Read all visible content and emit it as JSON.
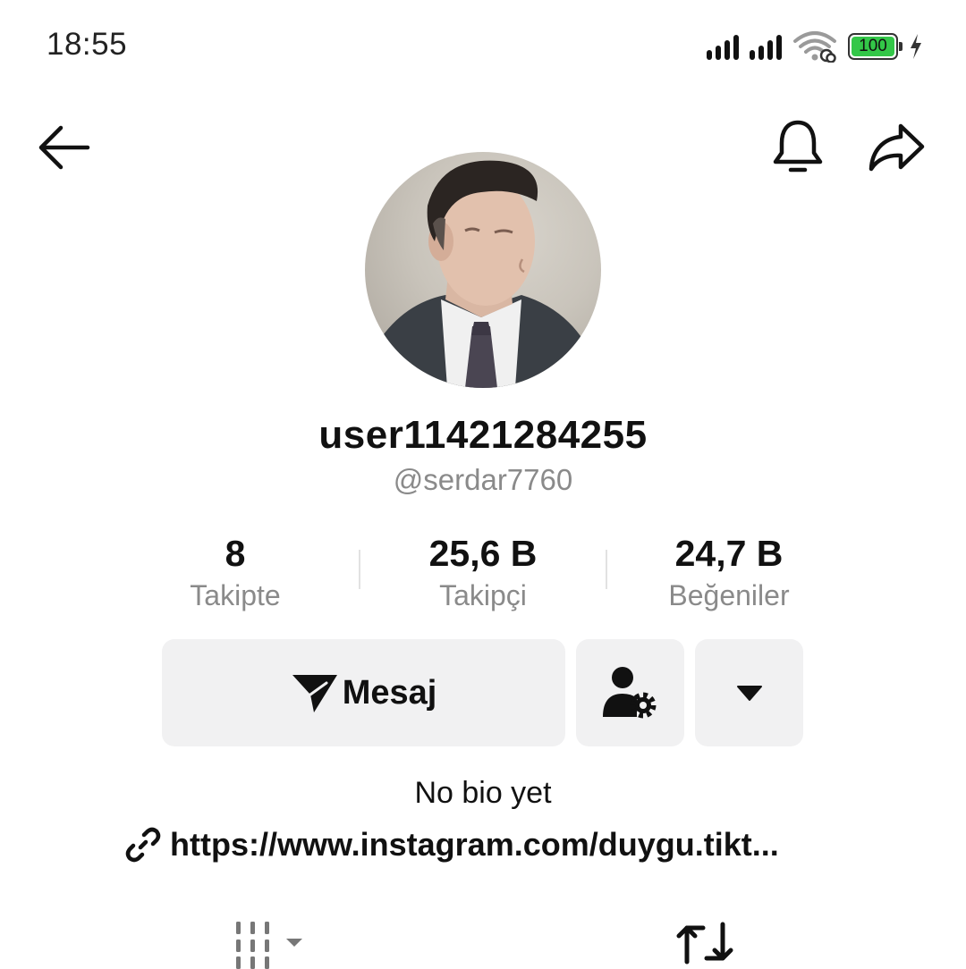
{
  "status_bar": {
    "time": "18:55",
    "battery_level": "100",
    "battery_color": "#33c748",
    "icons": [
      "signal-icon",
      "signal-icon",
      "wifi-icon",
      "battery-icon",
      "charging-icon"
    ]
  },
  "top_nav": {
    "icons": [
      "back-arrow-icon",
      "bell-icon",
      "share-icon"
    ]
  },
  "profile": {
    "display_name": "user11421284255",
    "handle": "@serdar7760",
    "stats": [
      {
        "value": "8",
        "label": "Takipte"
      },
      {
        "value": "25,6 B",
        "label": "Takipçi"
      },
      {
        "value": "24,7 B",
        "label": "Beğeniler"
      }
    ],
    "bio": "No bio yet",
    "link": "https://www.instagram.com/duygu.tikt..."
  },
  "actions": {
    "message_label": "Mesaj",
    "icons": [
      "paper-plane-icon",
      "user-settings-icon",
      "caret-down-icon"
    ]
  },
  "tabs": {
    "icons": [
      "grid-icon",
      "repost-icon"
    ]
  },
  "colors": {
    "text": "#111111",
    "muted": "#8a8a8a",
    "button_bg": "#f1f1f2"
  }
}
